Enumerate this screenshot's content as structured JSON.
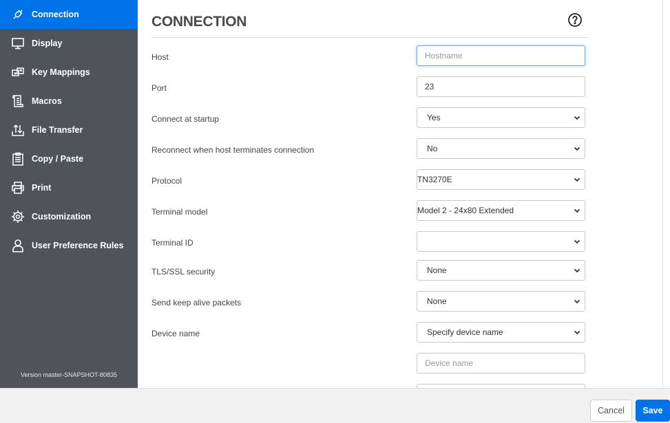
{
  "sidebar": {
    "items": [
      {
        "label": "Connection",
        "icon": "plug-icon",
        "active": true
      },
      {
        "label": "Display",
        "icon": "monitor-icon"
      },
      {
        "label": "Key Mappings",
        "icon": "key-mappings-icon"
      },
      {
        "label": "Macros",
        "icon": "scroll-icon"
      },
      {
        "label": "File Transfer",
        "icon": "transfer-arrows-icon"
      },
      {
        "label": "Copy / Paste",
        "icon": "clipboard-icon"
      },
      {
        "label": "Print",
        "icon": "printer-icon"
      },
      {
        "label": "Customization",
        "icon": "gear-icon"
      },
      {
        "label": "User Preference Rules",
        "icon": "user-icon"
      }
    ],
    "version": "Version master-SNAPSHOT-80835"
  },
  "main": {
    "title": "CONNECTION",
    "help_icon": "question-circle-icon",
    "fields": [
      {
        "label": "Host",
        "type": "input",
        "value": "",
        "placeholder": "Hostname",
        "focused": true
      },
      {
        "label": "Port",
        "type": "input",
        "value": "23",
        "placeholder": ""
      },
      {
        "label": "Connect at startup",
        "type": "select",
        "value": "Yes"
      },
      {
        "label": "Reconnect when host terminates connection",
        "type": "select",
        "value": "No"
      },
      {
        "label": "Protocol",
        "type": "select",
        "value": "TN3270E"
      },
      {
        "label": "Terminal model",
        "type": "select",
        "value": "Model 2 - 24x80 Extended"
      },
      {
        "label": "Terminal ID",
        "type": "select",
        "value": ""
      },
      {
        "label": "TLS/SSL security",
        "type": "select",
        "value": "None"
      },
      {
        "label": "Send keep alive packets",
        "type": "select",
        "value": "None"
      },
      {
        "label": "Device name",
        "type": "select",
        "value": "Specify device name"
      },
      {
        "label": "",
        "type": "input",
        "value": "",
        "placeholder": "Device name"
      }
    ]
  },
  "footer": {
    "cancel_label": "Cancel",
    "save_label": "Save"
  },
  "colors": {
    "accent": "#0073e7",
    "sidebar_bg": "#4f535a"
  }
}
